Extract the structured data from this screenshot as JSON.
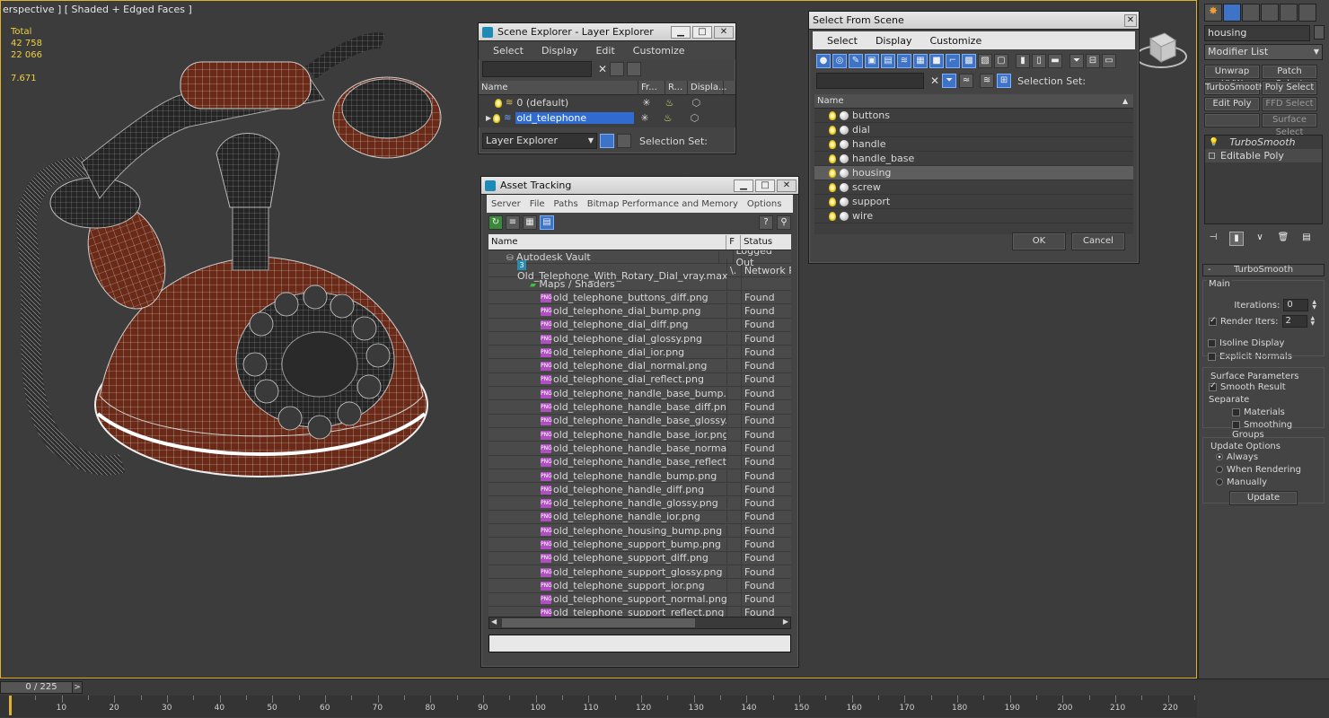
{
  "viewport": {
    "label": "erspective ] [ Shaded + Edged Faces ]",
    "stats": {
      "total_label": "Total",
      "polys": "42 758",
      "verts": "22 066",
      "fps": "7.671"
    }
  },
  "layer_explorer": {
    "title": "Scene Explorer - Layer Explorer",
    "menu": [
      "Select",
      "Display",
      "Edit",
      "Customize"
    ],
    "columns": [
      "Name",
      "Fr...",
      "R...",
      "Displa..."
    ],
    "layers": [
      {
        "name": "0 (default)",
        "selected": false
      },
      {
        "name": "old_telephone",
        "selected": true
      }
    ],
    "footer_dropdown": "Layer Explorer",
    "selection_set_label": "Selection Set:"
  },
  "select_from_scene": {
    "title": "Select From Scene",
    "menu": [
      "Select",
      "Display",
      "Customize"
    ],
    "selection_set_label": "Selection Set:",
    "column": "Name",
    "items": [
      {
        "name": "buttons",
        "selected": false
      },
      {
        "name": "dial",
        "selected": false
      },
      {
        "name": "handle",
        "selected": false
      },
      {
        "name": "handle_base",
        "selected": false
      },
      {
        "name": "housing",
        "selected": true
      },
      {
        "name": "screw",
        "selected": false
      },
      {
        "name": "support",
        "selected": false
      },
      {
        "name": "wire",
        "selected": false
      }
    ],
    "ok_label": "OK",
    "cancel_label": "Cancel"
  },
  "asset_tracking": {
    "title": "Asset Tracking",
    "menu": [
      "Server",
      "File",
      "Paths",
      "Bitmap Performance and Memory",
      "Options"
    ],
    "columns": [
      "Name",
      "F",
      "Status"
    ],
    "root": {
      "name": "Autodesk Vault",
      "status": "Logged Out"
    },
    "file": {
      "name": "Old_Telephone_With_Rotary_Dial_vray.max",
      "f": "\\.",
      "status": "Network Pat"
    },
    "group": "Maps / Shaders",
    "icon_text": "PNG",
    "maps": [
      {
        "name": "old_telephone_buttons_diff.png",
        "status": "Found"
      },
      {
        "name": "old_telephone_dial_bump.png",
        "status": "Found"
      },
      {
        "name": "old_telephone_dial_diff.png",
        "status": "Found"
      },
      {
        "name": "old_telephone_dial_glossy.png",
        "status": "Found"
      },
      {
        "name": "old_telephone_dial_ior.png",
        "status": "Found"
      },
      {
        "name": "old_telephone_dial_normal.png",
        "status": "Found"
      },
      {
        "name": "old_telephone_dial_reflect.png",
        "status": "Found"
      },
      {
        "name": "old_telephone_handle_base_bump.png",
        "status": "Found"
      },
      {
        "name": "old_telephone_handle_base_diff.png",
        "status": "Found"
      },
      {
        "name": "old_telephone_handle_base_glossy.png",
        "status": "Found"
      },
      {
        "name": "old_telephone_handle_base_ior.png",
        "status": "Found"
      },
      {
        "name": "old_telephone_handle_base_normal.png",
        "status": "Found"
      },
      {
        "name": "old_telephone_handle_base_reflect.png",
        "status": "Found"
      },
      {
        "name": "old_telephone_handle_bump.png",
        "status": "Found"
      },
      {
        "name": "old_telephone_handle_diff.png",
        "status": "Found"
      },
      {
        "name": "old_telephone_handle_glossy.png",
        "status": "Found"
      },
      {
        "name": "old_telephone_handle_ior.png",
        "status": "Found"
      },
      {
        "name": "old_telephone_housing_bump.png",
        "status": "Found"
      },
      {
        "name": "old_telephone_support_bump.png",
        "status": "Found"
      },
      {
        "name": "old_telephone_support_diff.png",
        "status": "Found"
      },
      {
        "name": "old_telephone_support_glossy.png",
        "status": "Found"
      },
      {
        "name": "old_telephone_support_ior.png",
        "status": "Found"
      },
      {
        "name": "old_telephone_support_normal.png",
        "status": "Found"
      },
      {
        "name": "old_telephone_support_reflect.png",
        "status": "Found"
      }
    ]
  },
  "command_panel": {
    "object_name": "housing",
    "modifier_list": "Modifier List",
    "buttons": [
      "Unwrap UVW",
      "Patch Select",
      "TurboSmooth",
      "Poly Select",
      "Edit Poly",
      "FFD Select",
      "",
      "Surface Select"
    ],
    "stack": [
      "TurboSmooth",
      "Editable Poly"
    ],
    "rollout_title": "TurboSmooth",
    "main_label": "Main",
    "iterations_label": "Iterations:",
    "iterations_value": "0",
    "render_iters_label": "Render Iters:",
    "render_iters_value": "2",
    "isoline_label": "Isoline Display",
    "explicit_normals_label": "Explicit Normals",
    "surface_params_label": "Surface Parameters",
    "smooth_result_label": "Smooth Result",
    "separate_label": "Separate",
    "materials_label": "Materials",
    "smoothing_groups_label": "Smoothing Groups",
    "update_options_label": "Update Options",
    "always_label": "Always",
    "when_rendering_label": "When Rendering",
    "manually_label": "Manually",
    "update_button": "Update"
  },
  "timeline": {
    "frame": "0 / 225",
    "ticks": [
      "10",
      "20",
      "30",
      "40",
      "50",
      "60",
      "70",
      "80",
      "90",
      "100",
      "110",
      "120",
      "130",
      "140",
      "150",
      "160",
      "170",
      "180",
      "190",
      "200",
      "210",
      "220"
    ]
  },
  "colors": {
    "selection": "#2f6bd0",
    "accent": "#e0b030",
    "wire_red": "#6e2a16"
  }
}
